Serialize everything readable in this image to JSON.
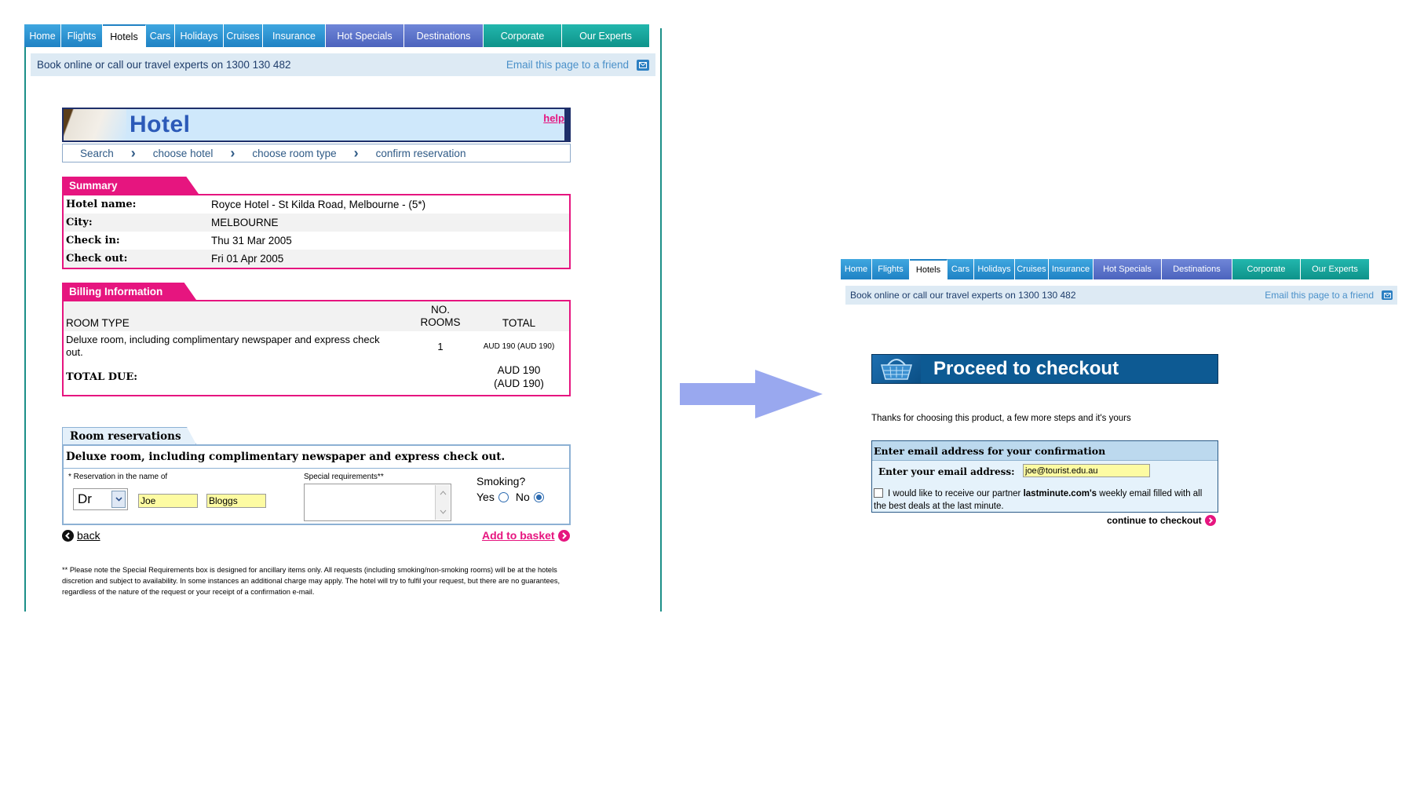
{
  "nav": {
    "tabs": [
      {
        "label": "Home",
        "style": "blue"
      },
      {
        "label": "Flights",
        "style": "blue"
      },
      {
        "label": "Hotels",
        "style": "active"
      },
      {
        "label": "Cars",
        "style": "blue"
      },
      {
        "label": "Holidays",
        "style": "blue"
      },
      {
        "label": "Cruises",
        "style": "blue"
      },
      {
        "label": "Insurance",
        "style": "blue"
      },
      {
        "label": "Hot Specials",
        "style": "purple"
      },
      {
        "label": "Destinations",
        "style": "purple"
      },
      {
        "label": "Corporate",
        "style": "green"
      },
      {
        "label": "Our Experts",
        "style": "green"
      }
    ]
  },
  "infobar": {
    "book_text": "Book online or call our travel experts on 1300 130 482",
    "email_link": "Email this page to a friend"
  },
  "hotel": {
    "banner_title": "Hotel",
    "help": "help",
    "breadcrumb": [
      "Search",
      "choose hotel",
      "choose room type",
      "confirm reservation"
    ],
    "summary": {
      "tab": "Summary",
      "rows": [
        {
          "label": "Hotel name:",
          "value": "Royce Hotel - St Kilda Road, Melbourne - (5*)"
        },
        {
          "label": "City:",
          "value": "MELBOURNE"
        },
        {
          "label": "Check in:",
          "value": "Thu 31 Mar 2005"
        },
        {
          "label": "Check out:",
          "value": "Fri 01 Apr 2005"
        }
      ]
    },
    "billing": {
      "tab": "Billing Information",
      "col_room_type": "ROOM TYPE",
      "col_no_rooms_1": "NO.",
      "col_no_rooms_2": "ROOMS",
      "col_total": "TOTAL",
      "room_desc": "Deluxe room, including complimentary newspaper and express check out.",
      "rooms": "1",
      "line_total": "AUD 190 (AUD 190)",
      "total_label": "TOTAL DUE:",
      "total_1": "AUD 190",
      "total_2": "(AUD 190)"
    },
    "reservations": {
      "tab": "Room reservations",
      "room_heading": "Deluxe room, including complimentary newspaper and express check out.",
      "name_label": "* Reservation in the name of",
      "title_value": "Dr",
      "first_name": "Joe",
      "last_name": "Bloggs",
      "special_label": "Special requirements**",
      "smoking_label": "Smoking?",
      "yes": "Yes",
      "no": "No",
      "smoking_selected": "No"
    },
    "back": "back",
    "add_to_basket": "Add to basket",
    "footnote": "** Please note the Special Requirements box is designed for ancillary items only. All requests (including smoking/non-smoking rooms) will be at the hotels discretion and subject to availability. In some instances an additional charge may apply. The hotel will try to fulfil your request, but there are no guarantees, regardless of the nature of the request or your receipt of a confirmation e-mail."
  },
  "checkout": {
    "banner_title": "Proceed to checkout",
    "thanks": "Thanks for choosing this product, a few more steps and it's yours",
    "box_heading": "Enter email address for your confirmation",
    "email_label": "Enter your email address:",
    "email_value": "joe@tourist.edu.au",
    "optin_prefix": "I would like to receive our partner ",
    "optin_brand": "lastminute.com's",
    "optin_suffix": " weekly email filled with all the best deals at the last minute.",
    "continue": "continue to checkout"
  },
  "colors": {
    "pink": "#e6157f",
    "tab_blue": "#1f82c4",
    "tab_purple": "#4c63bd",
    "tab_green": "#0e938a",
    "arrow": "#99a8ef",
    "checkout_banner": "#0d5a93"
  },
  "icons": {
    "mail": "envelope-icon",
    "back": "left-circle-arrow-icon",
    "add": "right-circle-arrow-icon",
    "continue": "right-circle-arrow-icon",
    "basket": "shopping-basket-icon",
    "select": "chevron-down-icon"
  }
}
